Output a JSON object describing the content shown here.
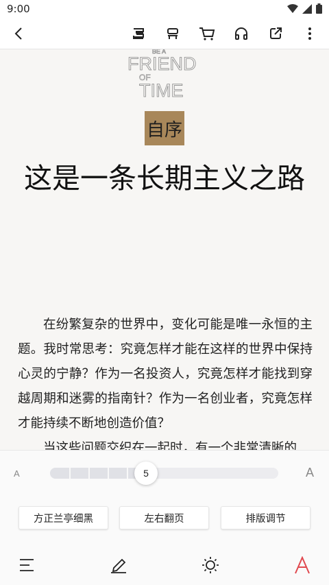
{
  "status_bar": {
    "time": "9:00",
    "icons": [
      "wifi-icon",
      "signal-icon",
      "battery-icon"
    ]
  },
  "toolbar": {
    "buttons": [
      "back-arrow-icon",
      "book-text-icon",
      "book-list-icon",
      "cart-icon",
      "headphones-icon",
      "share-icon",
      "more-vertical-icon"
    ]
  },
  "book": {
    "logo_text": [
      "BE A",
      "FRIEND",
      "OF",
      "TIME"
    ],
    "chapter_badge": "自序",
    "title": "这是一条长期主义之路",
    "paragraphs": [
      "在纷繁复杂的世界中，变化可能是唯一永恒的主题。我时常思考：究竟怎样才能在这样的世界中保持心灵的宁静？作为一名投资人，究竟怎样才能找到穿越周期和迷雾的指南针？作为一名创业者，究竟怎样才能持续不断地创造价值？",
      "当这些问题交织在一起时，有一个非常清晰的"
    ]
  },
  "settings": {
    "font_small_label": "A",
    "font_large_label": "A",
    "font_size_value": "5",
    "font_size_level": 5,
    "font_size_steps": 16,
    "buttons": [
      "方正兰亭细黑",
      "左右翻页",
      "排版调节"
    ]
  },
  "bottom_nav": {
    "icons": [
      "menu-icon",
      "note-pen-icon",
      "brightness-icon",
      "font-settings-icon"
    ]
  },
  "colors": {
    "accent_red": "#e0484e",
    "badge_bg": "#a8875a",
    "page_bg": "#f7f6f4"
  }
}
